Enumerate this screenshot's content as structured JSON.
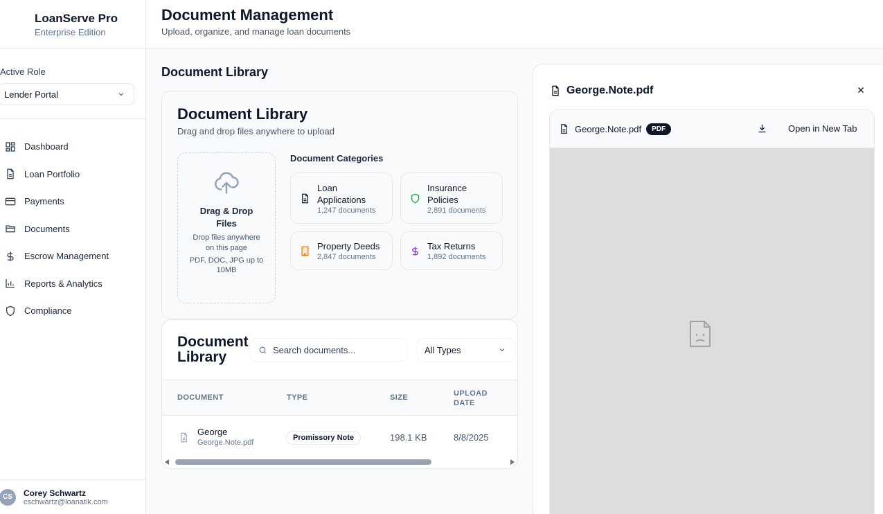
{
  "sidebar": {
    "brand": "LoanServe Pro",
    "edition": "Enterprise Edition",
    "role_label": "Active Role",
    "role_value": "Lender Portal",
    "items": [
      {
        "label": "Dashboard",
        "icon": "dashboard-icon"
      },
      {
        "label": "Loan Portfolio",
        "icon": "file-icon"
      },
      {
        "label": "Payments",
        "icon": "credit-card-icon"
      },
      {
        "label": "Documents",
        "icon": "folder-icon"
      },
      {
        "label": "Escrow Management",
        "icon": "dollar-icon"
      },
      {
        "label": "Reports & Analytics",
        "icon": "bar-chart-icon"
      },
      {
        "label": "Compliance",
        "icon": "shield-icon"
      }
    ],
    "user": {
      "initials": "CS",
      "name": "Corey Schwartz",
      "email": "cschwartz@loanatik.com"
    }
  },
  "header": {
    "title": "Document Management",
    "subtitle": "Upload, organize, and manage loan documents"
  },
  "main": {
    "section_title": "Document Library",
    "upload": {
      "title": "Document Library",
      "subtitle": "Drag and drop files anywhere to upload",
      "dropzone_title": "Drag & Drop Files",
      "dropzone_desc": "Drop files anywhere on this page",
      "dropzone_hint": "PDF, DOC, JPG up to 10MB",
      "categories_title": "Document Categories",
      "categories": [
        {
          "name": "Loan Applications",
          "count": "1,247 documents",
          "icon": "document-icon",
          "color": "#0f172a"
        },
        {
          "name": "Insurance Policies",
          "count": "2,891 documents",
          "icon": "shield-icon",
          "color": "#16a34a"
        },
        {
          "name": "Property Deeds",
          "count": "2,847 documents",
          "icon": "building-icon",
          "color": "#d97706"
        },
        {
          "name": "Tax Returns",
          "count": "1,892 documents",
          "icon": "dollar-icon",
          "color": "#9333ea"
        }
      ]
    },
    "library": {
      "title": "Document Library",
      "search_placeholder": "Search documents...",
      "type_filter": "All Types",
      "columns": [
        "Document",
        "Type",
        "Size",
        "Upload Date"
      ],
      "rows": [
        {
          "name": "George",
          "file": "George.Note.pdf",
          "type": "Promissory Note",
          "size": "198.1 KB",
          "date": "8/8/2025"
        }
      ]
    }
  },
  "preview": {
    "title": "George.Note.pdf",
    "file": "George.Note.pdf",
    "badge": "PDF",
    "open_label": "Open in New Tab"
  }
}
